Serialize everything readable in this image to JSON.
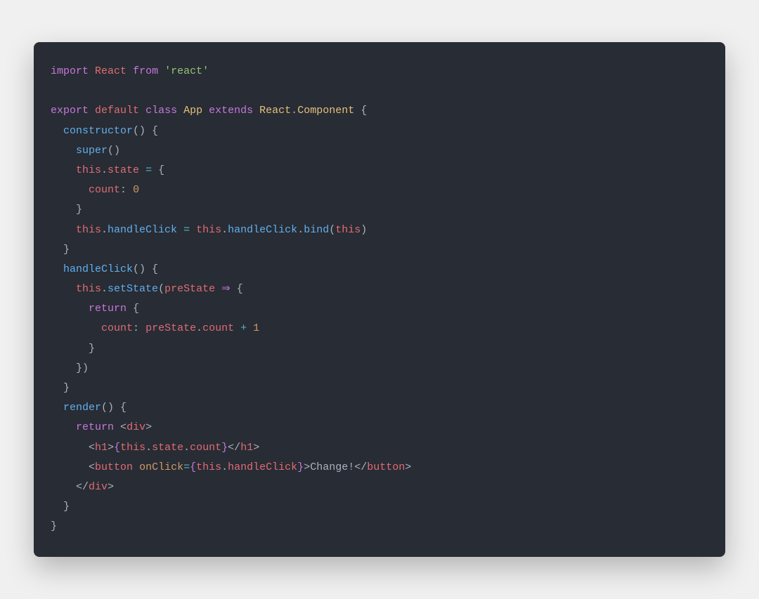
{
  "colors": {
    "bg": "#282c34",
    "default": "#abb2bf",
    "keyword_purple": "#c678dd",
    "keyword_red": "#e06c75",
    "string_green": "#98c379",
    "class_yellow": "#e5c07b",
    "func_blue": "#61afee",
    "number_orange": "#d19a66",
    "cyan": "#56b6c2",
    "operator": "#56b6c2"
  },
  "code": {
    "lines": [
      [
        {
          "t": "import",
          "c": "keyword_purple"
        },
        {
          "t": " ",
          "c": "default"
        },
        {
          "t": "React",
          "c": "keyword_red"
        },
        {
          "t": " ",
          "c": "default"
        },
        {
          "t": "from",
          "c": "keyword_purple"
        },
        {
          "t": " ",
          "c": "default"
        },
        {
          "t": "'react'",
          "c": "string_green"
        }
      ],
      [],
      [
        {
          "t": "export",
          "c": "keyword_purple"
        },
        {
          "t": " ",
          "c": "default"
        },
        {
          "t": "default",
          "c": "keyword_red"
        },
        {
          "t": " ",
          "c": "default"
        },
        {
          "t": "class",
          "c": "keyword_purple"
        },
        {
          "t": " ",
          "c": "default"
        },
        {
          "t": "App",
          "c": "class_yellow"
        },
        {
          "t": " ",
          "c": "default"
        },
        {
          "t": "extends",
          "c": "keyword_purple"
        },
        {
          "t": " ",
          "c": "default"
        },
        {
          "t": "React",
          "c": "class_yellow"
        },
        {
          "t": ".",
          "c": "default"
        },
        {
          "t": "Component",
          "c": "class_yellow"
        },
        {
          "t": " {",
          "c": "default"
        }
      ],
      [
        {
          "t": "  ",
          "c": "default"
        },
        {
          "t": "constructor",
          "c": "func_blue"
        },
        {
          "t": "() {",
          "c": "default"
        }
      ],
      [
        {
          "t": "    ",
          "c": "default"
        },
        {
          "t": "super",
          "c": "func_blue"
        },
        {
          "t": "()",
          "c": "default"
        }
      ],
      [
        {
          "t": "    ",
          "c": "default"
        },
        {
          "t": "this",
          "c": "keyword_red"
        },
        {
          "t": ".",
          "c": "default"
        },
        {
          "t": "state",
          "c": "keyword_red"
        },
        {
          "t": " ",
          "c": "default"
        },
        {
          "t": "=",
          "c": "operator"
        },
        {
          "t": " {",
          "c": "default"
        }
      ],
      [
        {
          "t": "      ",
          "c": "default"
        },
        {
          "t": "count",
          "c": "keyword_red"
        },
        {
          "t": ":",
          "c": "default"
        },
        {
          "t": " ",
          "c": "default"
        },
        {
          "t": "0",
          "c": "number_orange"
        }
      ],
      [
        {
          "t": "    }",
          "c": "default"
        }
      ],
      [
        {
          "t": "    ",
          "c": "default"
        },
        {
          "t": "this",
          "c": "keyword_red"
        },
        {
          "t": ".",
          "c": "default"
        },
        {
          "t": "handleClick",
          "c": "func_blue"
        },
        {
          "t": " ",
          "c": "default"
        },
        {
          "t": "=",
          "c": "operator"
        },
        {
          "t": " ",
          "c": "default"
        },
        {
          "t": "this",
          "c": "keyword_red"
        },
        {
          "t": ".",
          "c": "default"
        },
        {
          "t": "handleClick",
          "c": "func_blue"
        },
        {
          "t": ".",
          "c": "default"
        },
        {
          "t": "bind",
          "c": "func_blue"
        },
        {
          "t": "(",
          "c": "default"
        },
        {
          "t": "this",
          "c": "keyword_red"
        },
        {
          "t": ")",
          "c": "default"
        }
      ],
      [
        {
          "t": "  }",
          "c": "default"
        }
      ],
      [
        {
          "t": "  ",
          "c": "default"
        },
        {
          "t": "handleClick",
          "c": "func_blue"
        },
        {
          "t": "() {",
          "c": "default"
        }
      ],
      [
        {
          "t": "    ",
          "c": "default"
        },
        {
          "t": "this",
          "c": "keyword_red"
        },
        {
          "t": ".",
          "c": "default"
        },
        {
          "t": "setState",
          "c": "func_blue"
        },
        {
          "t": "(",
          "c": "default"
        },
        {
          "t": "preState",
          "c": "keyword_red"
        },
        {
          "t": " ",
          "c": "default"
        },
        {
          "t": "⇒",
          "c": "keyword_purple"
        },
        {
          "t": " {",
          "c": "default"
        }
      ],
      [
        {
          "t": "      ",
          "c": "default"
        },
        {
          "t": "return",
          "c": "keyword_purple"
        },
        {
          "t": " {",
          "c": "default"
        }
      ],
      [
        {
          "t": "        ",
          "c": "default"
        },
        {
          "t": "count",
          "c": "keyword_red"
        },
        {
          "t": ":",
          "c": "default"
        },
        {
          "t": " ",
          "c": "default"
        },
        {
          "t": "preState",
          "c": "keyword_red"
        },
        {
          "t": ".",
          "c": "default"
        },
        {
          "t": "count",
          "c": "keyword_red"
        },
        {
          "t": " ",
          "c": "default"
        },
        {
          "t": "+",
          "c": "operator"
        },
        {
          "t": " ",
          "c": "default"
        },
        {
          "t": "1",
          "c": "number_orange"
        }
      ],
      [
        {
          "t": "      }",
          "c": "default"
        }
      ],
      [
        {
          "t": "    })",
          "c": "default"
        }
      ],
      [
        {
          "t": "  }",
          "c": "default"
        }
      ],
      [
        {
          "t": "  ",
          "c": "default"
        },
        {
          "t": "render",
          "c": "func_blue"
        },
        {
          "t": "() {",
          "c": "default"
        }
      ],
      [
        {
          "t": "    ",
          "c": "default"
        },
        {
          "t": "return",
          "c": "keyword_purple"
        },
        {
          "t": " ",
          "c": "default"
        },
        {
          "t": "<",
          "c": "default"
        },
        {
          "t": "div",
          "c": "keyword_red"
        },
        {
          "t": ">",
          "c": "default"
        }
      ],
      [
        {
          "t": "      ",
          "c": "default"
        },
        {
          "t": "<",
          "c": "default"
        },
        {
          "t": "h1",
          "c": "keyword_red"
        },
        {
          "t": ">",
          "c": "default"
        },
        {
          "t": "{",
          "c": "keyword_purple"
        },
        {
          "t": "this",
          "c": "keyword_red"
        },
        {
          "t": ".",
          "c": "default"
        },
        {
          "t": "state",
          "c": "keyword_red"
        },
        {
          "t": ".",
          "c": "default"
        },
        {
          "t": "count",
          "c": "keyword_red"
        },
        {
          "t": "}",
          "c": "keyword_purple"
        },
        {
          "t": "</",
          "c": "default"
        },
        {
          "t": "h1",
          "c": "keyword_red"
        },
        {
          "t": ">",
          "c": "default"
        }
      ],
      [
        {
          "t": "      ",
          "c": "default"
        },
        {
          "t": "<",
          "c": "default"
        },
        {
          "t": "button",
          "c": "keyword_red"
        },
        {
          "t": " ",
          "c": "default"
        },
        {
          "t": "onClick",
          "c": "number_orange"
        },
        {
          "t": "=",
          "c": "operator"
        },
        {
          "t": "{",
          "c": "keyword_purple"
        },
        {
          "t": "this",
          "c": "keyword_red"
        },
        {
          "t": ".",
          "c": "default"
        },
        {
          "t": "handleClick",
          "c": "keyword_red"
        },
        {
          "t": "}",
          "c": "keyword_purple"
        },
        {
          "t": ">",
          "c": "default"
        },
        {
          "t": "Change!",
          "c": "default"
        },
        {
          "t": "</",
          "c": "default"
        },
        {
          "t": "button",
          "c": "keyword_red"
        },
        {
          "t": ">",
          "c": "default"
        }
      ],
      [
        {
          "t": "    ",
          "c": "default"
        },
        {
          "t": "</",
          "c": "default"
        },
        {
          "t": "div",
          "c": "keyword_red"
        },
        {
          "t": ">",
          "c": "default"
        }
      ],
      [
        {
          "t": "  }",
          "c": "default"
        }
      ],
      [
        {
          "t": "}",
          "c": "default"
        }
      ]
    ]
  }
}
